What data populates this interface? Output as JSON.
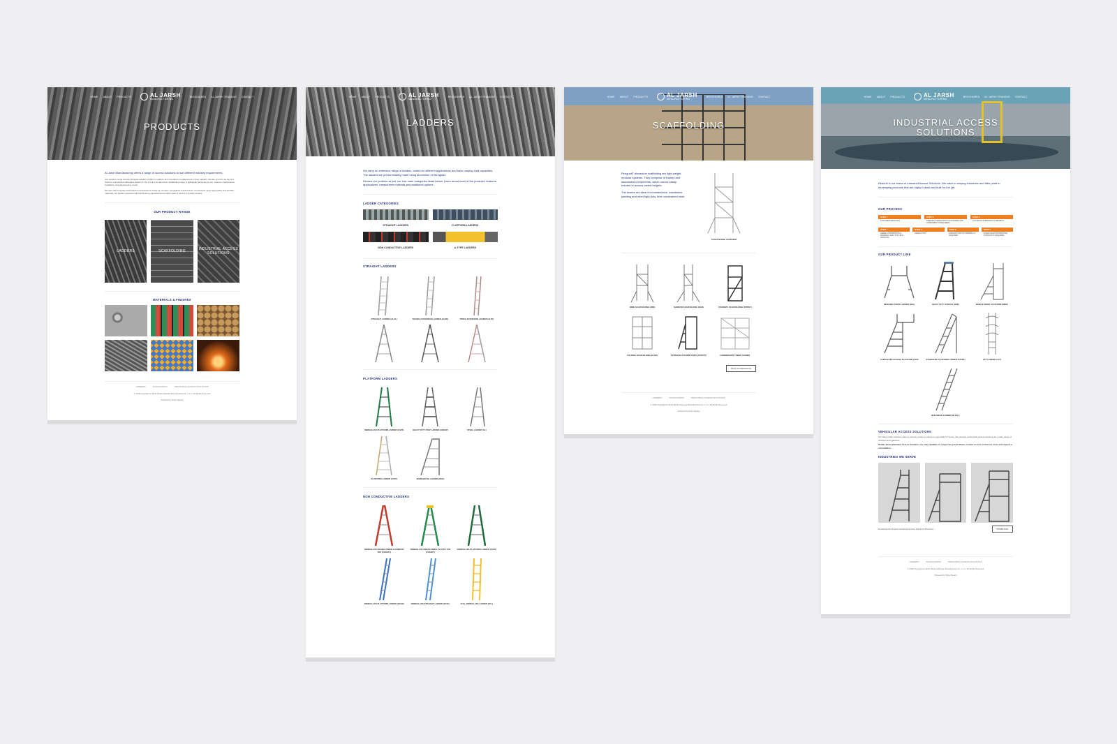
{
  "brand": {
    "name": "AL JARSH",
    "sub": "MANUFACTURING"
  },
  "nav": {
    "home": "HOME",
    "about": "ABOUT",
    "products": "PRODUCTS",
    "brochures": "BROCHURES",
    "training": "AL JARSH TRAINING",
    "contact": "CONTACT"
  },
  "footer": {
    "links": [
      "LADDERS",
      "SCAFFOLDING",
      "INDUSTRIAL ACCESS SOLUTIONS"
    ],
    "copyright": "© 2018 Copyright Al Jarsh Metal Fabricate Manufacturing Co. L.L.C. All Rights Reserved",
    "powered": "Powered by Nicky Design"
  },
  "page1": {
    "title": "PRODUCTS",
    "intro": "Al Jarsh Manufacturing offers a range of access solutions to suit different industry requirements.",
    "p1": "Our Ladders range includes Straight Ladders, Platform Ladders, Non Conductive Ladders and A-Type Ladders. We are proud to be the first brand to manufacture fibreglass ladders in the U.A.E. Our aluminium Scaffolding range is lightweight and easy to use, suited to maintenance, installation and warehousing needs.",
    "p2": "We also offer bespoke Industrial Access Solutions suited for complex, specialised requirements. Constructed using high quality and durable materials, our ladders possess high load bearing capacities and enable ease of access to greater heights.",
    "range_heading": "OUR PRODUCT RANGE",
    "range": [
      "LADDERS",
      "SCAFFOLDING",
      "INDUSTRIAL ACCESS SOLUTIONS"
    ],
    "materials_heading": "MATERIALS & FINISHES"
  },
  "page2": {
    "title": "LADDERS",
    "intro1": "We carry an extensive range of ladders, suited for different applications and have varying load capacities. The ladders are predominantly made using aluminium or fibreglass.",
    "intro2": "Review our portfolio as per our four main categories listed below. Learn about each of the products' features, applications, measurement details and additional options.",
    "categories_heading": "LADDER CATEGORIES",
    "categories": [
      "STRAIGHT LADDERS",
      "PLATFORM LADDERS",
      "NON CONDUCTIVE LADDERS",
      "A-TYPE LADDERS"
    ],
    "straight_heading": "STRAIGHT LADDERS",
    "straight": [
      "STRAIGHT LADDER (ALSL)",
      "DOUBLE EXTENSION LADDER (ALDE)",
      "TRIPLE EXTENSION LADDER (ALTE)"
    ],
    "platform_heading": "PLATFORM LADDERS",
    "platform": [
      "FIBREGLASS PLATFORM LADDER (FGPF)",
      "HEAVY DUTY STEP LADDER (ADHSP)",
      "STEEL LADDER (SL)",
      "PLATFORM LADDER (ALPF)",
      "WAREHOUSE LADDER (WHL)"
    ],
    "nonconductive_heading": "NON CONDUCTIVE LADDERS",
    "nonconductive": [
      "FIBREGLASS DOUBLE SIDED ALUMINIUM TOP (FGDSAT)",
      "FIBREGLASS SINGLE SIDED PLASTIC TOP (FGSSPT)",
      "FIBREGLASS PLATFORM LADDER (FGPF)",
      "FIBREGLASS PLATFORM LADDER (FGSX)",
      "FIBREGLASS STRAIGHT LADDER (FGSL)",
      "FULL FIBREGLASS LADDER (FFL)"
    ]
  },
  "page3": {
    "title": "SCAFFOLDING",
    "p1": "Penguin® aluminium scaffolding are light-weight, modular systems. They comprise of frames and associated components, which can be easily erected to access varied heights.",
    "p2": "The towers are ideal for maintenance, installation, painting and other light-duty, time constrained work.",
    "overview": "SCAFFOLDING OVERVIEW",
    "items": [
      "WIDE SCAFFOLDING (WID)",
      "NARROW SCAFFOLDING (NAR)",
      "STAIRWAY SCAFFOLDING (STRWY)",
      "FOLDING SCAFFOLDING (FLDS)",
      "PODIUM PLATFORM STEPS (PODSTP)",
      "COMBINATION TOWER (COMBI)"
    ],
    "back": "BACK TO PRODUCTS"
  },
  "page4": {
    "title": "INDUSTRIAL ACCESS SOLUTIONS",
    "intro": "Reachit is our brand of Industrial Access Solutions. We cater to varying industries and take pride in developing products that are highly robust and built for the job.",
    "process_heading": "OUR PROCESS",
    "steps": [
      {
        "label": "STEP 1",
        "text": "CUSTOMER SENDS RFQ"
      },
      {
        "label": "STEP 2",
        "text": "DIMENSION VERIFICATION (IF POSSIBLE SITE ASSESSMENT IS REQUIRED)"
      },
      {
        "label": "STEP 3",
        "text": "QUOTATION SUBMISSION & FEEDBACK"
      },
      {
        "label": "STEP 4",
        "text": "ORDER CONFIRMATION & DRAWINGS SENT FOR FINAL APPROVAL"
      },
      {
        "label": "STEP 5",
        "text": "PRODUCTION"
      },
      {
        "label": "STEP 6",
        "text": "DISPATCH AND ON-ASSEMBLY IF REQUIRED"
      },
      {
        "label": "STEP 7",
        "text": "AFTER SALES MAINTENANCE CONTRACT IF REQUIRED"
      }
    ],
    "product_heading": "OUR PRODUCT LINE",
    "products": [
      "BRIDGING STEPS LADDER (BSL)",
      "HEAVY DUTY STOOLS (HDS)",
      "MOBILE WORK PLATFORM (MWP)",
      "CANTILEVER ACCESS PLATFORM (CAP)",
      "STAIRCASE PLATFORM LADDER (STSPF)",
      "CAT LADDER (CAT)",
      "BULKHEAD LADDER (BLKHL)"
    ],
    "vehicular_heading": "VEHICULAR ACCESS SOLUTIONS",
    "vehicular_p1": "Our tailor-made solutions cater to various modes of transport; especially for trucks. We develop customised access solutions for a wide range of vehicles and industries.",
    "vehicular_p2": "Details about Vehicular Access Solutions are only available on request by email. Please contact us here to find out more and request a consultation.",
    "industries_heading": "INDUSTRIES WE SERVE",
    "download_text": "Download the Reachit Vehicular Access Solutions Brochure",
    "download_btn": "DOWNLOAD"
  },
  "colors": {
    "navy": "#1c2e7a",
    "orange": "#ef7d22",
    "background": "#efeff1"
  }
}
